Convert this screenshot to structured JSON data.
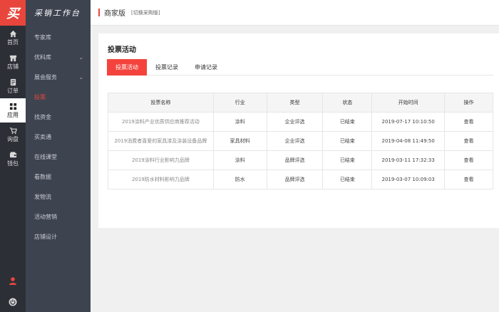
{
  "rail": {
    "logo": "买",
    "items": [
      {
        "label": "首页",
        "icon": "home-icon"
      },
      {
        "label": "店铺",
        "icon": "store-icon"
      },
      {
        "label": "订单",
        "icon": "order-icon"
      },
      {
        "label": "应用",
        "icon": "apps-icon"
      },
      {
        "label": "询盘",
        "icon": "cart-icon"
      },
      {
        "label": "钱包",
        "icon": "wallet-icon"
      }
    ]
  },
  "sidebar": {
    "title": "采销工作台",
    "items": [
      {
        "label": "专家库",
        "chevron": ""
      },
      {
        "label": "优料库",
        "chevron": "⌄"
      },
      {
        "label": "展会服务",
        "chevron": "⌄"
      },
      {
        "label": "投票",
        "chevron": ""
      },
      {
        "label": "找资金",
        "chevron": ""
      },
      {
        "label": "买卖通",
        "chevron": ""
      },
      {
        "label": "在线课堂",
        "chevron": ""
      },
      {
        "label": "看数据",
        "chevron": ""
      },
      {
        "label": "发物流",
        "chevron": ""
      },
      {
        "label": "活动营销",
        "chevron": ""
      },
      {
        "label": "店铺设计",
        "chevron": ""
      }
    ]
  },
  "header": {
    "title": "商家版",
    "switch_link": "[切换采购版]"
  },
  "main": {
    "title": "投票活动",
    "tabs": [
      {
        "label": "投票活动"
      },
      {
        "label": "投票记录"
      },
      {
        "label": "申请记录"
      }
    ],
    "table": {
      "columns": [
        "投票名称",
        "行业",
        "类型",
        "状态",
        "开始时间",
        "操作"
      ],
      "rows": [
        [
          "2019涂料产业优质供应商推荐活动",
          "涂料",
          "企业评选",
          "已结束",
          "2019-07-17 10:10:50",
          "查看"
        ],
        [
          "2019消费者喜爱的家具漆及涂装设备品牌",
          "家具材料",
          "企业评选",
          "已结束",
          "2019-04-08 11:49:50",
          "查看"
        ],
        [
          "2019涂料行业影响力品牌",
          "涂料",
          "品牌评选",
          "已结束",
          "2019-03-11 17:32:33",
          "查看"
        ],
        [
          "2019防水材料影响力品牌",
          "防水",
          "品牌评选",
          "已结束",
          "2019-03-07 10:09:03",
          "查看"
        ]
      ]
    }
  },
  "colors": {
    "accent": "#e8463c",
    "rail_bg": "#2c2f36",
    "sidebar_bg": "#3e4350"
  }
}
